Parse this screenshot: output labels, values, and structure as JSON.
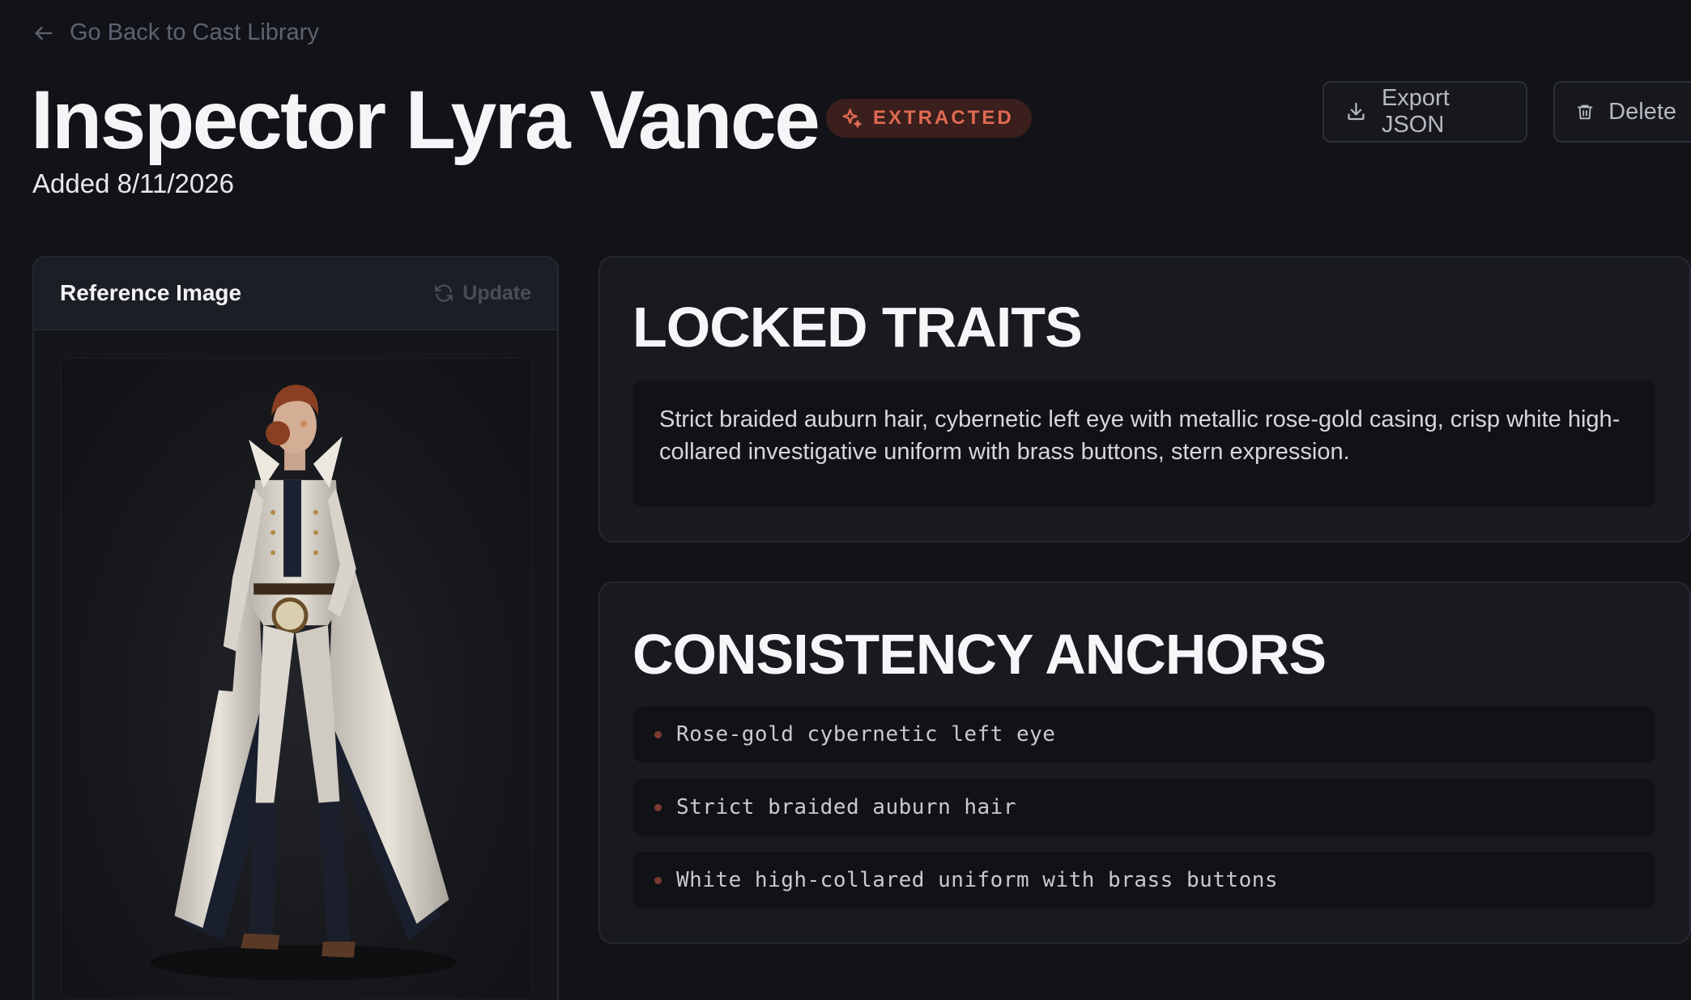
{
  "nav": {
    "back_label": "Go Back to Cast Library"
  },
  "character": {
    "name": "Inspector Lyra Vance",
    "status_badge": "EXTRACTED",
    "added": "Added 8/11/2026"
  },
  "actions": {
    "export_label": "Export JSON",
    "delete_label": "Delete"
  },
  "reference": {
    "title": "Reference Image",
    "update_label": "Update"
  },
  "locked_traits": {
    "heading": "LOCKED TRAITS",
    "text": "Strict braided auburn hair, cybernetic left eye with metallic rose-gold casing, crisp white high-collared investigative uniform with brass buttons, stern expression."
  },
  "anchors": {
    "heading": "CONSISTENCY ANCHORS",
    "items": [
      "Rose-gold cybernetic left eye",
      "Strict braided auburn hair",
      "White high-collared uniform with brass buttons"
    ]
  },
  "colors": {
    "accent": "#e06a52",
    "background": "#121318",
    "card": "#191a20"
  }
}
